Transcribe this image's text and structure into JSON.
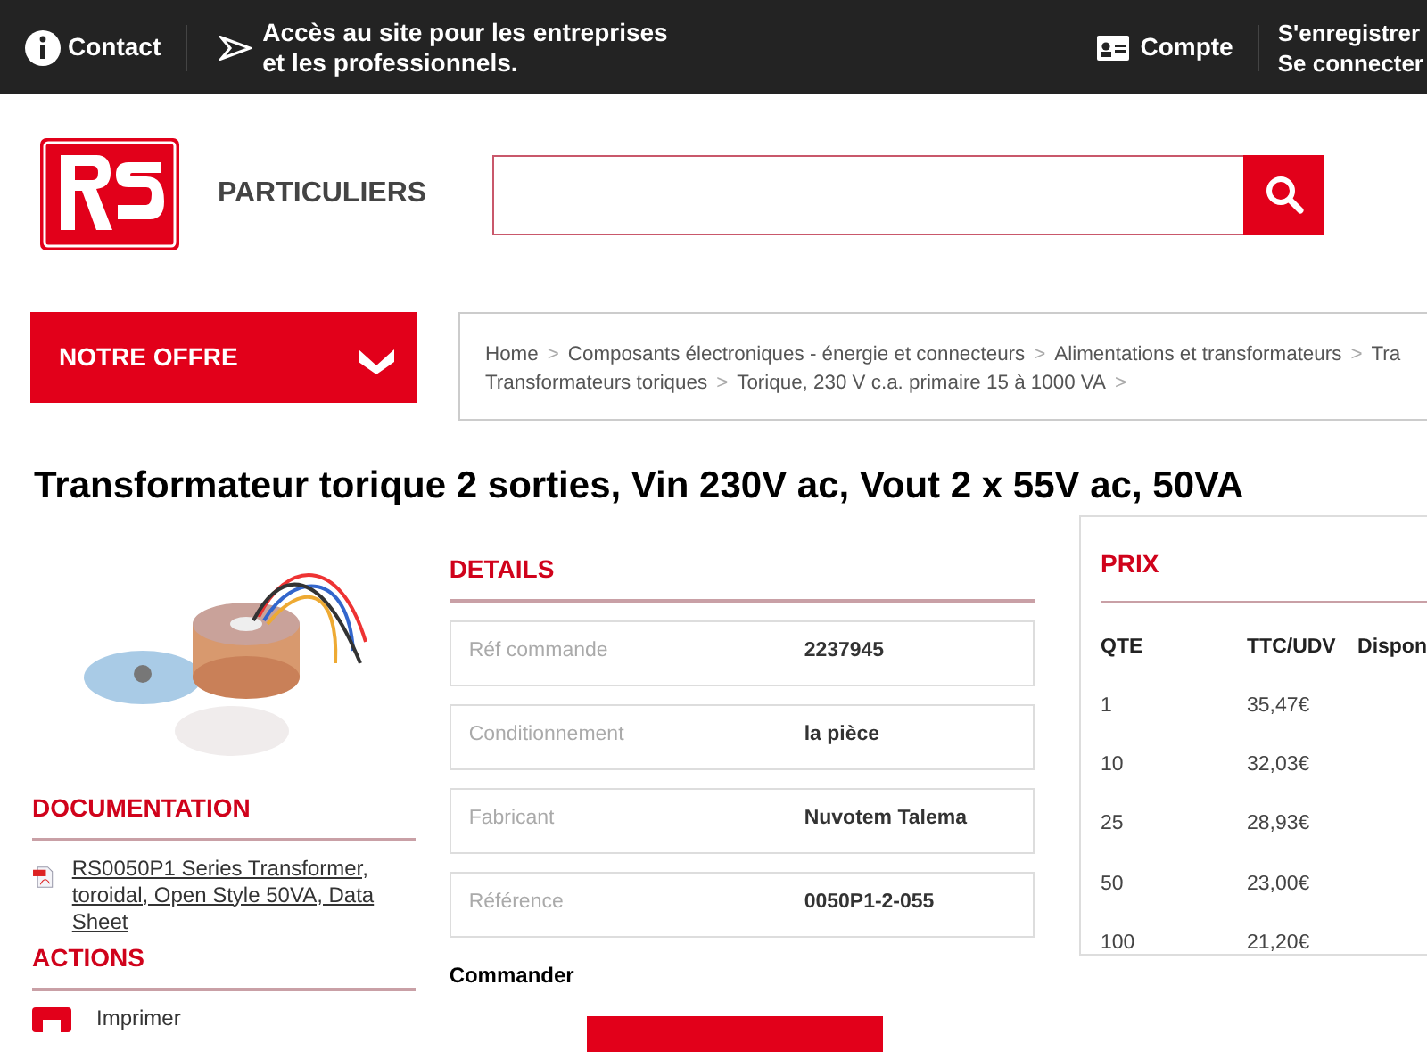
{
  "topbar": {
    "contact": "Contact",
    "pro_access": [
      "Accès au site pour les entreprises",
      "et les professionnels."
    ],
    "account": "Compte",
    "register": "S'enregistrer",
    "login": "Se connecter"
  },
  "header": {
    "segment": "PARTICULIERS"
  },
  "nav": {
    "menu_button": "NOTRE OFFRE",
    "breadcrumb": [
      [
        {
          "kind": "link",
          "text": "Home"
        },
        {
          "kind": "separator",
          "text": ">"
        },
        {
          "kind": "link",
          "text": "Composants électroniques - énergie et connecteurs"
        },
        {
          "kind": "separator",
          "text": ">"
        },
        {
          "kind": "link",
          "text": "Alimentations et transformateurs"
        },
        {
          "kind": "separator",
          "text": ">"
        },
        {
          "kind": "link",
          "text": "Tra"
        }
      ],
      [
        {
          "kind": "link",
          "text": "Transformateurs toriques"
        },
        {
          "kind": "separator",
          "text": ">"
        },
        {
          "kind": "link",
          "text": "Torique, 230 V c.a. primaire 15 à 1000 VA"
        },
        {
          "kind": "separator",
          "text": ">"
        }
      ]
    ]
  },
  "product": {
    "title": "Transformateur torique 2 sorties, Vin 230V ac, Vout 2 x 55V ac, 50VA"
  },
  "documentation": {
    "heading": "DOCUMENTATION",
    "link": "RS0050P1 Series Transformer, toroidal, Open Style 50VA, Data Sheet"
  },
  "actions": {
    "heading": "ACTIONS",
    "items": [
      "Imprimer"
    ]
  },
  "details": {
    "heading": "DETAILS",
    "rows": [
      {
        "label": "Réf commande",
        "value": "2237945"
      },
      {
        "label": "Conditionnement",
        "value": "la pièce"
      },
      {
        "label": "Fabricant",
        "value": "Nuvotem Talema"
      },
      {
        "label": "Référence",
        "value": "0050P1-2-055"
      }
    ],
    "order_label": "Commander"
  },
  "prices": {
    "heading": "PRIX",
    "columns": [
      "QTE",
      "TTC/UDV",
      "Dispon"
    ],
    "rows": [
      {
        "qty": "1",
        "price": "35,47€"
      },
      {
        "qty": "10",
        "price": "32,03€"
      },
      {
        "qty": "25",
        "price": "28,93€"
      },
      {
        "qty": "50",
        "price": "23,00€"
      },
      {
        "qty": "100",
        "price": "21,20€"
      }
    ]
  }
}
